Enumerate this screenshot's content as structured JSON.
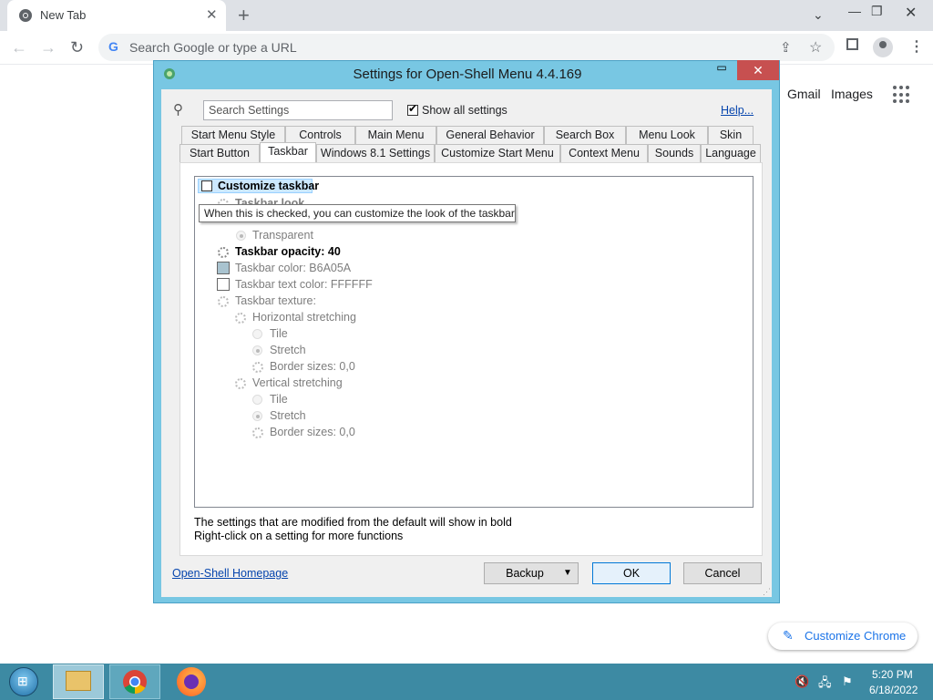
{
  "browser": {
    "tab_title": "New Tab",
    "omnibox_placeholder": "Search Google or type a URL",
    "links": {
      "gmail": "Gmail",
      "images": "Images"
    },
    "customize_chrome": "Customize Chrome"
  },
  "dialog": {
    "title": "Settings for Open-Shell Menu 4.4.169",
    "search_placeholder": "Search Settings",
    "show_all_label": "Show all settings",
    "help_link": "Help...",
    "tabs_row1": [
      "Start Menu Style",
      "Controls",
      "Main Menu",
      "General Behavior",
      "Search Box",
      "Menu Look",
      "Skin"
    ],
    "tabs_row2": [
      "Start Button",
      "Taskbar",
      "Windows 8.1 Settings",
      "Customize Start Menu",
      "Context Menu",
      "Sounds",
      "Language"
    ],
    "active_tab": "Taskbar",
    "settings": {
      "customize_taskbar": "Customize taskbar",
      "taskbar_look": "Taskbar look",
      "transparent": "Transparent",
      "opacity": "Taskbar opacity: 40",
      "color": "Taskbar color: B6A05A",
      "text_color": "Taskbar text color: FFFFFF",
      "texture": "Taskbar texture:",
      "horizontal": "Horizontal stretching",
      "h_tile": "Tile",
      "h_stretch": "Stretch",
      "h_border": "Border sizes: 0,0",
      "vertical": "Vertical stretching",
      "v_tile": "Tile",
      "v_stretch": "Stretch",
      "v_border": "Border sizes: 0,0"
    },
    "tooltip": "When this is checked, you can customize the look of the taskbar",
    "note1": "The settings that are modified from the default will show in bold",
    "note2": "Right-click on a setting for more functions",
    "homepage_link": "Open-Shell Homepage",
    "buttons": {
      "backup": "Backup",
      "ok": "OK",
      "cancel": "Cancel"
    },
    "colors": {
      "taskbar_color_swatch": "#a9c3cf",
      "title_bar": "#78c7e3",
      "close_button": "#c75050"
    }
  },
  "taskbar": {
    "time": "5:20 PM",
    "date": "6/18/2022"
  }
}
